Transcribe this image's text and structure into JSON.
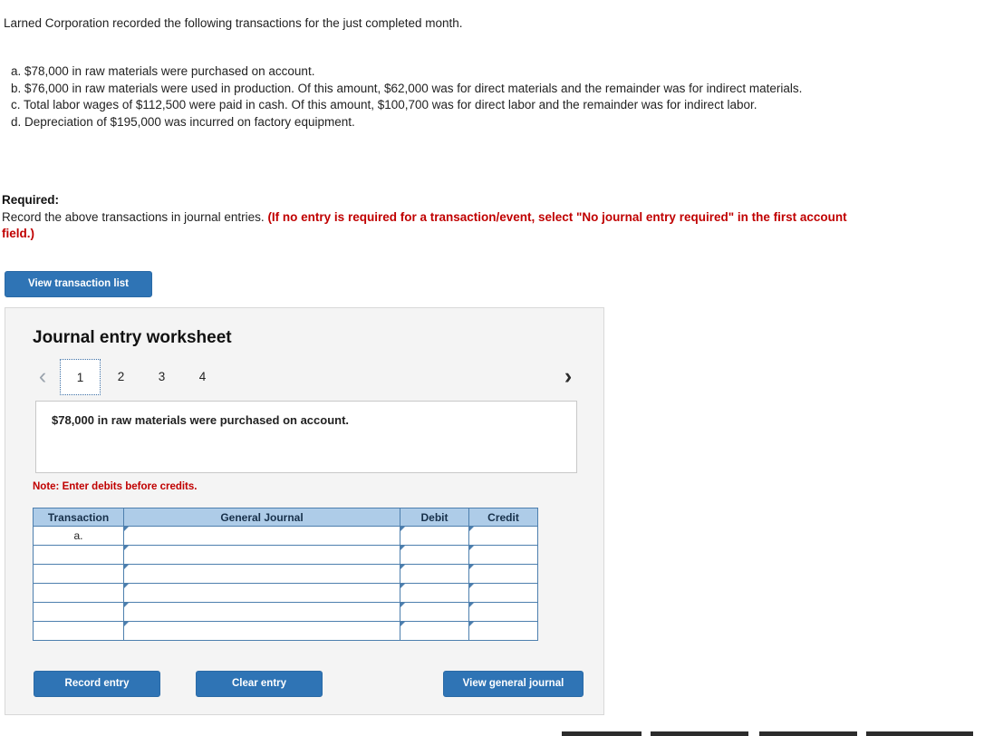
{
  "intro": "Larned Corporation recorded the following transactions for the just completed month.",
  "transactions": [
    "a. $78,000 in raw materials were purchased on account.",
    "b. $76,000 in raw materials were used in production. Of this amount, $62,000 was for direct materials and the remainder was for indirect materials.",
    "c. Total labor wages of $112,500 were paid in cash. Of this amount, $100,700 was for direct labor and the remainder was for indirect labor.",
    "d. Depreciation of $195,000 was incurred on factory equipment."
  ],
  "required": {
    "label": "Required:",
    "text": "Record the above transactions in journal entries.",
    "emphasis": "(If no entry is required for a transaction/event, select \"No journal entry required\" in the first account field.)"
  },
  "buttons": {
    "view_transaction_list": "View transaction list",
    "record_entry": "Record entry",
    "clear_entry": "Clear entry",
    "view_general_journal": "View general journal"
  },
  "worksheet": {
    "title": "Journal entry worksheet",
    "prev_icon": "chevron-left-icon",
    "next_icon": "chevron-right-icon",
    "tabs": [
      {
        "label": "1",
        "active": true
      },
      {
        "label": "2",
        "active": false
      },
      {
        "label": "3",
        "active": false
      },
      {
        "label": "4",
        "active": false
      }
    ],
    "statement": "$78,000 in raw materials were purchased on account.",
    "note": "Note: Enter debits before credits.",
    "table": {
      "headers": [
        "Transaction",
        "General Journal",
        "Debit",
        "Credit"
      ],
      "rows": [
        {
          "transaction": "a.",
          "general_journal": "",
          "debit": "",
          "credit": ""
        },
        {
          "transaction": "",
          "general_journal": "",
          "debit": "",
          "credit": ""
        },
        {
          "transaction": "",
          "general_journal": "",
          "debit": "",
          "credit": ""
        },
        {
          "transaction": "",
          "general_journal": "",
          "debit": "",
          "credit": ""
        },
        {
          "transaction": "",
          "general_journal": "",
          "debit": "",
          "credit": ""
        },
        {
          "transaction": "",
          "general_journal": "",
          "debit": "",
          "credit": ""
        }
      ]
    }
  },
  "colors": {
    "button_blue": "#2f74b5",
    "header_blue": "#aecce8",
    "required_red": "#c00000"
  }
}
